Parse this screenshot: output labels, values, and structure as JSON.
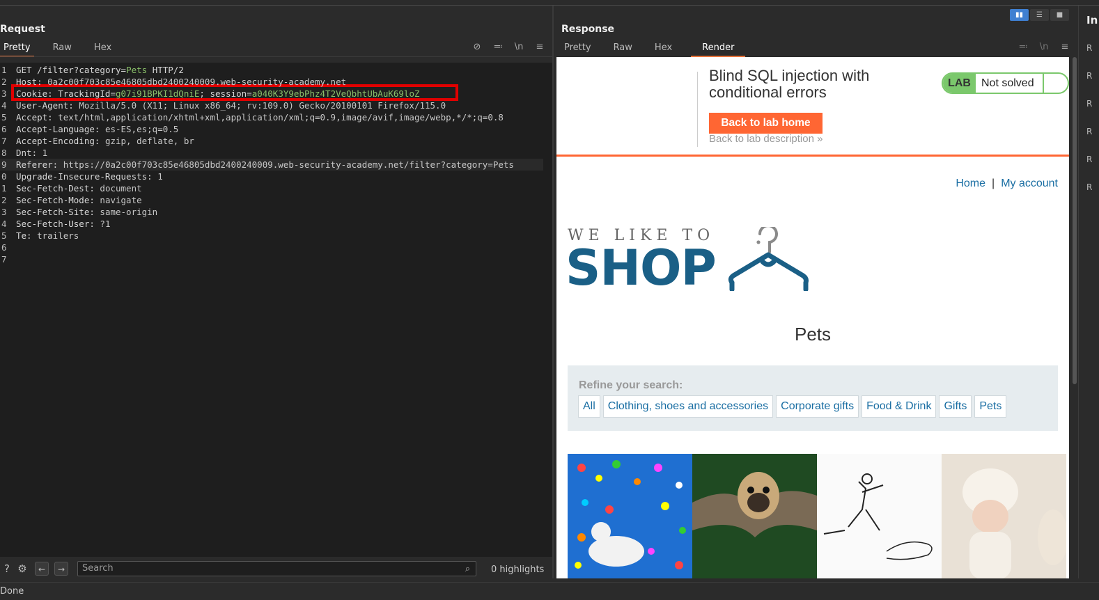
{
  "request": {
    "title": "Request",
    "tabs": [
      "Pretty",
      "Raw",
      "Hex"
    ],
    "active_tab": "Pretty",
    "lines": [
      {
        "n": "1",
        "parts": [
          {
            "t": "GET /filter?",
            "c": "hname"
          },
          {
            "t": "category",
            "c": "hname"
          },
          {
            "t": "=",
            "c": "hname"
          },
          {
            "t": "Pets",
            "c": "grn"
          },
          {
            "t": " HTTP/2",
            "c": "hname"
          }
        ]
      },
      {
        "n": "2",
        "parts": [
          {
            "t": "Host: ",
            "c": "hname"
          },
          {
            "t": "0a2c00f703c85e46805dbd2400240009.web-security-academy.net",
            "c": "hval"
          }
        ]
      },
      {
        "n": "3",
        "parts": [
          {
            "t": "Cookie: TrackingId=",
            "c": "hname"
          },
          {
            "t": "g07i91BPKI1dQniE",
            "c": "grn"
          },
          {
            "t": "; session=",
            "c": "hname"
          },
          {
            "t": "a040K3Y9ebPhz4T2VeQbhtUbAuK69loZ",
            "c": "grn"
          }
        ]
      },
      {
        "n": "4",
        "parts": [
          {
            "t": "User-Agent: ",
            "c": "hname"
          },
          {
            "t": "Mozilla/5.0 (X11; Linux x86_64; rv:109.0) Gecko/20100101 Firefox/115.0",
            "c": "hval"
          }
        ]
      },
      {
        "n": "5",
        "parts": [
          {
            "t": "Accept: ",
            "c": "hname"
          },
          {
            "t": "text/html,application/xhtml+xml,application/xml;q=0.9,image/avif,image/webp,*/*;q=0.8",
            "c": "hval"
          }
        ]
      },
      {
        "n": "6",
        "parts": [
          {
            "t": "Accept-Language: ",
            "c": "hname"
          },
          {
            "t": "es-ES,es;q=0.5",
            "c": "hval"
          }
        ]
      },
      {
        "n": "7",
        "parts": [
          {
            "t": "Accept-Encoding: ",
            "c": "hname"
          },
          {
            "t": "gzip, deflate, br",
            "c": "hval"
          }
        ]
      },
      {
        "n": "8",
        "parts": [
          {
            "t": "Dnt: ",
            "c": "hname"
          },
          {
            "t": "1",
            "c": "hval"
          }
        ]
      },
      {
        "n": "9",
        "parts": [
          {
            "t": "Referer: ",
            "c": "hname"
          },
          {
            "t": "https://0a2c00f703c85e46805dbd2400240009.web-security-academy.net/filter?category=Pets",
            "c": "hval"
          }
        ]
      },
      {
        "n": "0",
        "parts": [
          {
            "t": "Upgrade-Insecure-Requests: ",
            "c": "hname"
          },
          {
            "t": "1",
            "c": "hval"
          }
        ]
      },
      {
        "n": "1",
        "parts": [
          {
            "t": "Sec-Fetch-Dest: ",
            "c": "hname"
          },
          {
            "t": "document",
            "c": "hval"
          }
        ]
      },
      {
        "n": "2",
        "parts": [
          {
            "t": "Sec-Fetch-Mode: ",
            "c": "hname"
          },
          {
            "t": "navigate",
            "c": "hval"
          }
        ]
      },
      {
        "n": "3",
        "parts": [
          {
            "t": "Sec-Fetch-Site: ",
            "c": "hname"
          },
          {
            "t": "same-origin",
            "c": "hval"
          }
        ]
      },
      {
        "n": "4",
        "parts": [
          {
            "t": "Sec-Fetch-User: ",
            "c": "hname"
          },
          {
            "t": "?1",
            "c": "hval"
          }
        ]
      },
      {
        "n": "5",
        "parts": [
          {
            "t": "Te: ",
            "c": "hname"
          },
          {
            "t": "trailers",
            "c": "hval"
          }
        ]
      },
      {
        "n": "6",
        "parts": []
      },
      {
        "n": "7",
        "parts": []
      }
    ],
    "search_placeholder": "Search",
    "highlights": "0 highlights"
  },
  "response": {
    "title": "Response",
    "tabs": [
      "Pretty",
      "Raw",
      "Hex",
      "Render"
    ],
    "active_tab": "Render",
    "render": {
      "lab_title": "Blind SQL injection with conditional errors",
      "back_button": "Back to lab home",
      "back_desc": "Back to lab description",
      "lab_badge": "LAB",
      "lab_state": "Not solved",
      "nav_home": "Home",
      "nav_sep": "|",
      "nav_account": "My account",
      "logo_small": "WE LIKE TO",
      "logo_big": "SHOP",
      "category_title": "Pets",
      "refine_label": "Refine your search:",
      "filters": [
        "All",
        "Clothing, shoes and accessories",
        "Corporate gifts",
        "Food & Drink",
        "Gifts",
        "Pets"
      ]
    }
  },
  "right_strip": {
    "head": "In",
    "items": [
      "R",
      "R",
      "R",
      "R",
      "R",
      "R"
    ]
  },
  "status": "Done"
}
